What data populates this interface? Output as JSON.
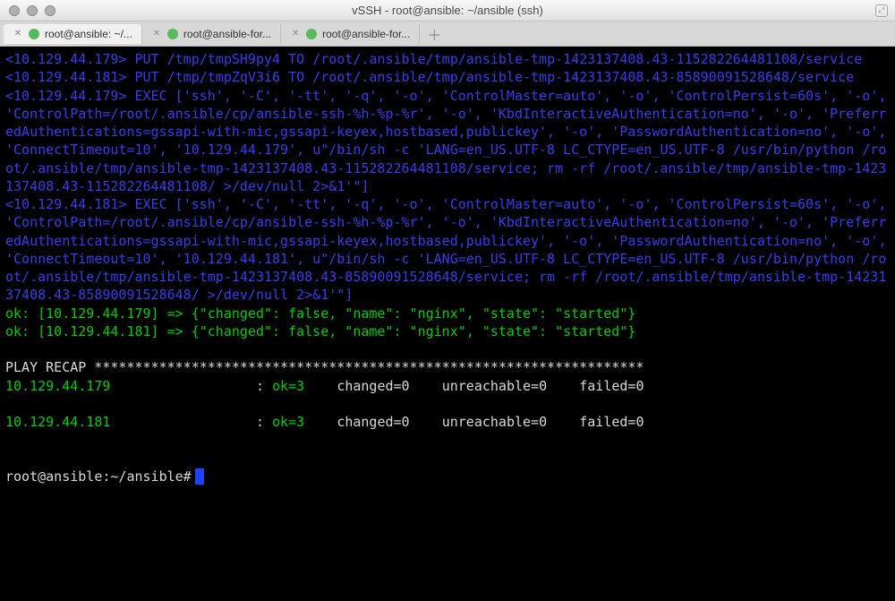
{
  "window": {
    "title": "vSSH - root@ansible: ~/ansible (ssh)"
  },
  "tabs": {
    "items": [
      {
        "label": "root@ansible: ~/..."
      },
      {
        "label": "root@ansible-for..."
      },
      {
        "label": "root@ansible-for..."
      }
    ]
  },
  "term": {
    "put1_host": "<10.129.44.179>",
    "put1_rest": " PUT /tmp/tmpSH9py4 TO /root/.ansible/tmp/ansible-tmp-1423137408.43-115282264481108/service",
    "put2_host": "<10.129.44.181>",
    "put2_rest": " PUT /tmp/tmpZqV3i6 TO /root/.ansible/tmp/ansible-tmp-1423137408.43-85890091528648/service",
    "exec1_host": "<10.129.44.179>",
    "exec1_rest": " EXEC ['ssh', '-C', '-tt', '-q', '-o', 'ControlMaster=auto', '-o', 'ControlPersist=60s', '-o', 'ControlPath=/root/.ansible/cp/ansible-ssh-%h-%p-%r', '-o', 'KbdInteractiveAuthentication=no', '-o', 'PreferredAuthentications=gssapi-with-mic,gssapi-keyex,hostbased,publickey', '-o', 'PasswordAuthentication=no', '-o', 'ConnectTimeout=10', '10.129.44.179', u\"/bin/sh -c 'LANG=en_US.UTF-8 LC_CTYPE=en_US.UTF-8 /usr/bin/python /root/.ansible/tmp/ansible-tmp-1423137408.43-115282264481108/service; rm -rf /root/.ansible/tmp/ansible-tmp-1423137408.43-115282264481108/ >/dev/null 2>&1'\"]",
    "exec2_host": "<10.129.44.181>",
    "exec2_rest": " EXEC ['ssh', '-C', '-tt', '-q', '-o', 'ControlMaster=auto', '-o', 'ControlPersist=60s', '-o', 'ControlPath=/root/.ansible/cp/ansible-ssh-%h-%p-%r', '-o', 'KbdInteractiveAuthentication=no', '-o', 'PreferredAuthentications=gssapi-with-mic,gssapi-keyex,hostbased,publickey', '-o', 'PasswordAuthentication=no', '-o', 'ConnectTimeout=10', '10.129.44.181', u\"/bin/sh -c 'LANG=en_US.UTF-8 LC_CTYPE=en_US.UTF-8 /usr/bin/python /root/.ansible/tmp/ansible-tmp-1423137408.43-85890091528648/service; rm -rf /root/.ansible/tmp/ansible-tmp-1423137408.43-85890091528648/ >/dev/null 2>&1'\"]",
    "ok1": "ok: [10.129.44.179] => {\"changed\": false, \"name\": \"nginx\", \"state\": \"started\"}",
    "ok2": "ok: [10.129.44.181] => {\"changed\": false, \"name\": \"nginx\", \"state\": \"started\"}",
    "recap_header": "PLAY RECAP ********************************************************************",
    "recap1_host": "10.129.44.179",
    "recap1_sep": ": ",
    "recap1_ok": "ok=3   ",
    "recap1_rest": " changed=0    unreachable=0    failed=0",
    "recap2_host": "10.129.44.181",
    "recap2_sep": ": ",
    "recap2_ok": "ok=3   ",
    "recap2_rest": " changed=0    unreachable=0    failed=0",
    "prompt": "root@ansible:~/ansible#"
  }
}
